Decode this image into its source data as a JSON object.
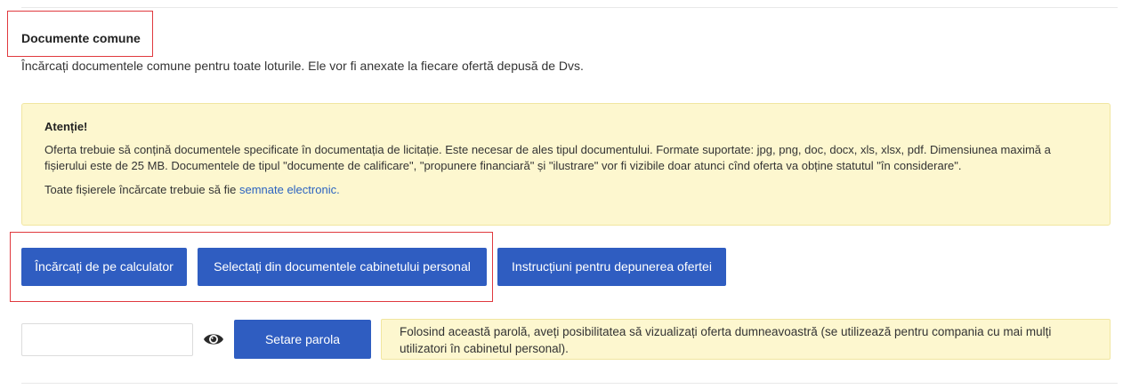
{
  "section": {
    "title": "Documente comune",
    "subtitle": "Încărcați documentele comune pentru toate loturile. Ele vor fi anexate la fiecare ofertă depusă de Dvs."
  },
  "alert": {
    "title": "Atenție!",
    "text": "Oferta trebuie să conțină documentele specificate în documentația de licitație. Este necesar de ales tipul documentului. Formate suportate: jpg, png, doc, docx, xls, xlsx, pdf. Dimensiunea maximă a fișierului este de 25 MB. Documentele de tipul \"documente de calificare\", \"propunere financiară\" și \"ilustrare\" vor fi vizibile doar atunci cînd oferta va obține statutul \"în considerare\".",
    "sign_prefix": "Toate fișierele încărcate trebuie să fie",
    "sign_link": "semnate electronic."
  },
  "buttons": {
    "upload": "Încărcați de pe calculator",
    "select": "Selectați din documentele cabinetului personal",
    "instructions": "Instrucțiuni pentru depunerea ofertei"
  },
  "password": {
    "value": "",
    "eye_icon": "eye-icon",
    "set_button": "Setare parola",
    "note": "Folosind această parolă, aveți posibilitatea să vizualizați oferta dumneavoastră (se utilizează pentru compania cu mai mulți utilizatori în cabinetul personal)."
  },
  "colors": {
    "primary_button": "#2f5dc1",
    "alert_background": "#fdf7cf",
    "link": "#2b63c0",
    "highlight_border": "#e0393e"
  }
}
